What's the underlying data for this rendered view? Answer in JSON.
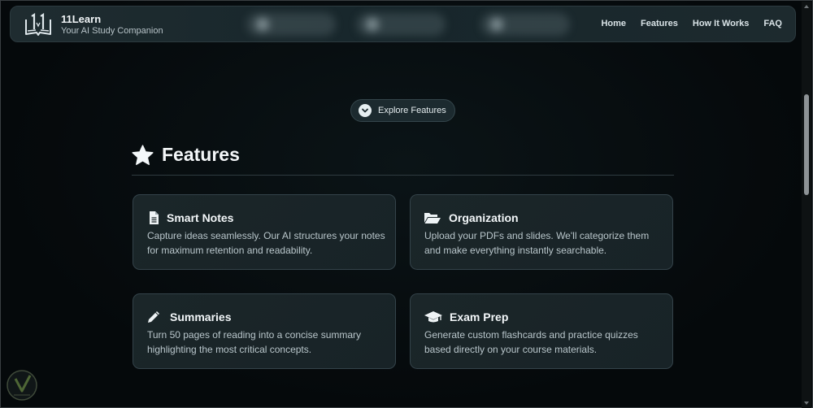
{
  "brand": {
    "name": "11Learn",
    "tagline": "Your AI Study Companion"
  },
  "nav": {
    "links": [
      "Home",
      "Features",
      "How It Works",
      "FAQ"
    ]
  },
  "explore": {
    "label": "Explore Features"
  },
  "section": {
    "title": "Features",
    "icon": "star-icon"
  },
  "cards": [
    {
      "title": "Smart Notes",
      "icon": "document-icon",
      "desc": "Capture ideas seamlessly. Our AI structures your notes for maximum retention and readability."
    },
    {
      "title": "Organization",
      "icon": "folder-open-icon",
      "desc": "Upload your PDFs and slides. We'll categorize them and make everything instantly searchable."
    },
    {
      "title": "Summaries",
      "icon": "pencil-icon",
      "desc": "Turn 50 pages of reading into a concise summary highlighting the most critical concepts."
    },
    {
      "title": "Exam Prep",
      "icon": "graduation-cap-icon",
      "desc": "Generate custom flashcards and practice quizzes based directly on your course materials."
    }
  ],
  "colors": {
    "background": "#05090b",
    "card": "#1b2629",
    "accent": "#e6eef1"
  }
}
